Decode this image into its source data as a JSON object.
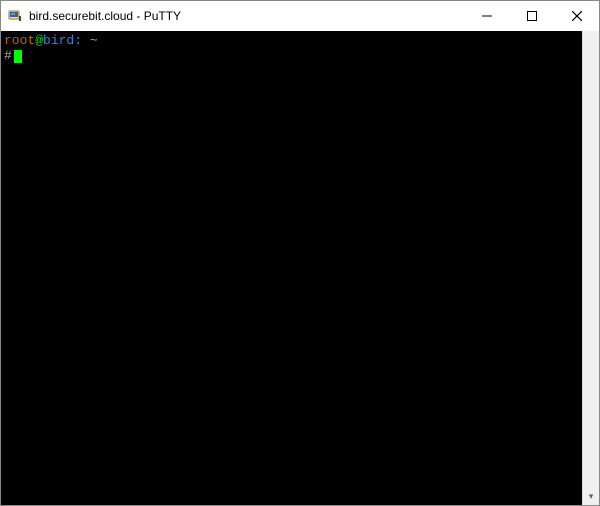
{
  "window": {
    "title": "bird.securebit.cloud - PuTTY",
    "icon": "putty-icon"
  },
  "controls": {
    "minimize": "minimize-button",
    "maximize": "maximize-button",
    "close": "close-button"
  },
  "terminal": {
    "prompt": {
      "user": "root",
      "at": "@",
      "host": "bird",
      "colon": ":",
      "path": " ~",
      "hash": "#"
    },
    "input": ""
  }
}
